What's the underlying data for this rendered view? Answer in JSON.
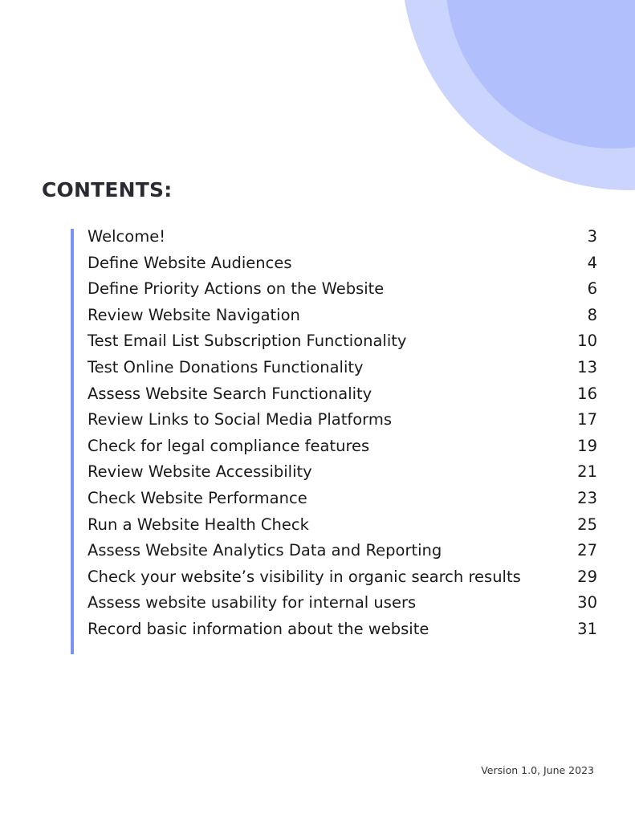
{
  "heading": "CONTENTS:",
  "toc": [
    {
      "title": "Welcome!",
      "page": "3"
    },
    {
      "title": "Define Website Audiences",
      "page": "4"
    },
    {
      "title": "Define Priority Actions on the Website",
      "page": "6"
    },
    {
      "title": "Review Website Navigation",
      "page": "8"
    },
    {
      "title": "Test Email List Subscription Functionality",
      "page": "10"
    },
    {
      "title": "Test Online Donations Functionality",
      "page": "13"
    },
    {
      "title": "Assess Website Search Functionality",
      "page": "16"
    },
    {
      "title": "Review Links to Social Media Platforms",
      "page": "17"
    },
    {
      "title": "Check for legal compliance features",
      "page": "19"
    },
    {
      "title": "Review Website Accessibility",
      "page": "21"
    },
    {
      "title": "Check Website Performance",
      "page": "23"
    },
    {
      "title": "Run a Website Health Check",
      "page": "25"
    },
    {
      "title": "Assess Website Analytics Data and Reporting",
      "page": "27"
    },
    {
      "title": "Check your website’s visibility in organic search results",
      "page": "29"
    },
    {
      "title": "Assess website usability for internal users",
      "page": "30"
    },
    {
      "title": "Record basic information about the website",
      "page": "31"
    }
  ],
  "footer": "Version 1.0, June 2023",
  "colors": {
    "accent_bar": "#7b93f3",
    "circle_light": "#cad4fd",
    "circle_dark": "#b1c0fd"
  }
}
